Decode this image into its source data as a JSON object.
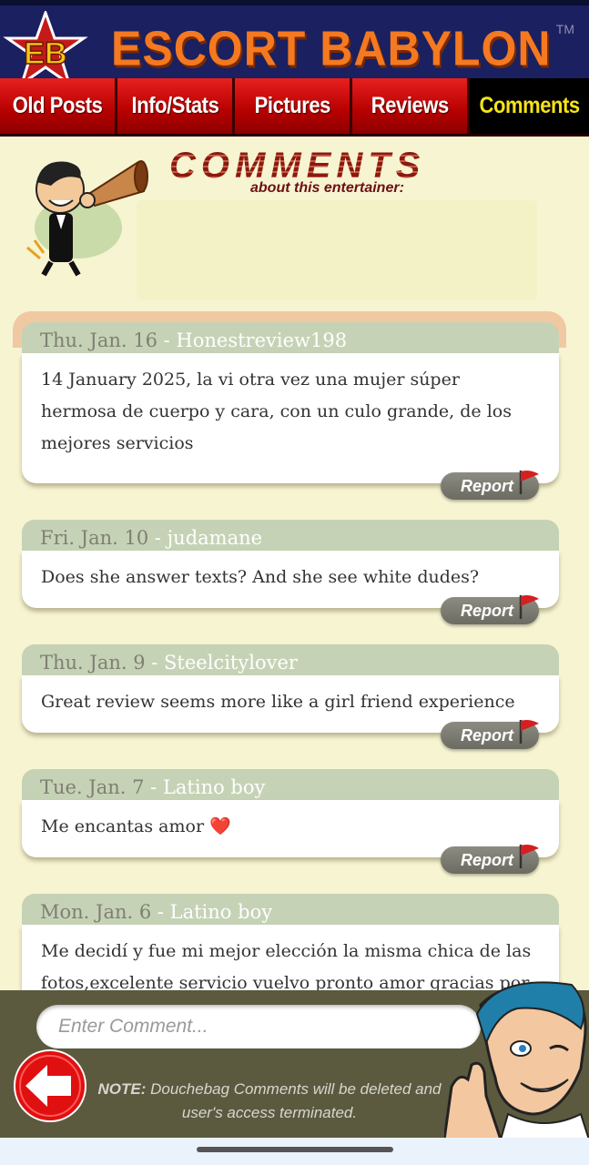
{
  "header": {
    "logo_text": "EB",
    "title": "ESCORT BABYLON",
    "tm": "TM"
  },
  "nav": {
    "tabs": [
      {
        "label": "Old Posts"
      },
      {
        "label": "Info/Stats"
      },
      {
        "label": "Pictures"
      },
      {
        "label": "Reviews"
      },
      {
        "label": "Comments",
        "active": true
      }
    ]
  },
  "banner": {
    "title": "COMMENTS",
    "subtitle": "about this entertainer:"
  },
  "comments": [
    {
      "date": "Thu. Jan. 16",
      "sep": " - ",
      "user": "Honestreview198",
      "text": "14 January 2025, la vi otra vez una mujer súper hermosa de cuerpo y cara, con un culo grande, de los mejores servicios",
      "report": "Report"
    },
    {
      "date": "Fri. Jan. 10",
      "sep": " - ",
      "user": "judamane",
      "text": "Does she answer texts? And she see white dudes?",
      "report": "Report"
    },
    {
      "date": "Thu. Jan. 9",
      "sep": " - ",
      "user": "Steelcitylover",
      "text": "Great review seems more like a girl friend experience",
      "report": "Report"
    },
    {
      "date": "Tue. Jan. 7",
      "sep": " - ",
      "user": "Latino boy",
      "text": "Me encantas amor",
      "emoji": "❤️",
      "report": "Report"
    },
    {
      "date": "Mon. Jan. 6",
      "sep": " - ",
      "user": "Latino boy",
      "text": "Me decidí y fue mi mejor elección la misma chica de las fotos,excelente servicio vuelvo pronto amor gracias por",
      "report": "Report"
    }
  ],
  "footer": {
    "input_placeholder": "Enter Comment...",
    "note_label": "NOTE:",
    "note_text": " Douchebag Comments will be deleted and user's access terminated."
  },
  "colors": {
    "header_bg": "#1a2060",
    "title_orange": "#f47920",
    "tab_red": "#e81f1f",
    "tab_active_text": "#f5e318",
    "page_bg": "#f7f4d2",
    "comment_head": "#c6d2b5",
    "footer_bg": "#5b5a3f"
  },
  "icons": [
    "eb-star-logo",
    "megaphone-mascot-icon",
    "flag-icon",
    "back-arrow-icon",
    "winking-guy-icon"
  ]
}
